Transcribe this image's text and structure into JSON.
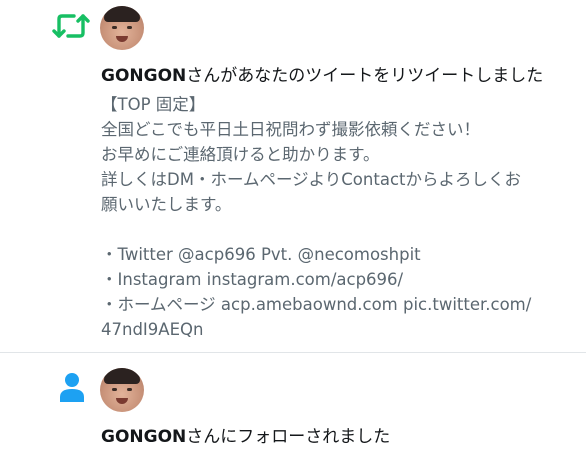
{
  "notifications": [
    {
      "type": "retweet",
      "icon": "retweet-icon",
      "user": "GONGON",
      "action_text": "さんがあなたのツイートをリツイートしました",
      "tweet_lines": [
        "【TOP 固定】",
        "全国どこでも平日土日祝問わず撮影依頼ください！",
        "お早めにご連絡頂けると助かります。",
        "詳しくはDM・ホームページよりContactからよろしくお",
        "願いいたします。",
        "",
        "・Twitter @acp696 Pvt. @necomoshpit",
        "・Instagram instagram.com/acp696/",
        "・ホームページ acp.amebaownd.com pic.twitter.com/",
        "47ndI9AEQn"
      ],
      "accent": "#17bf63"
    },
    {
      "type": "follow",
      "icon": "person-icon",
      "user": "GONGON",
      "action_text": "さんにフォローされました",
      "accent": "#1da1f2"
    }
  ]
}
